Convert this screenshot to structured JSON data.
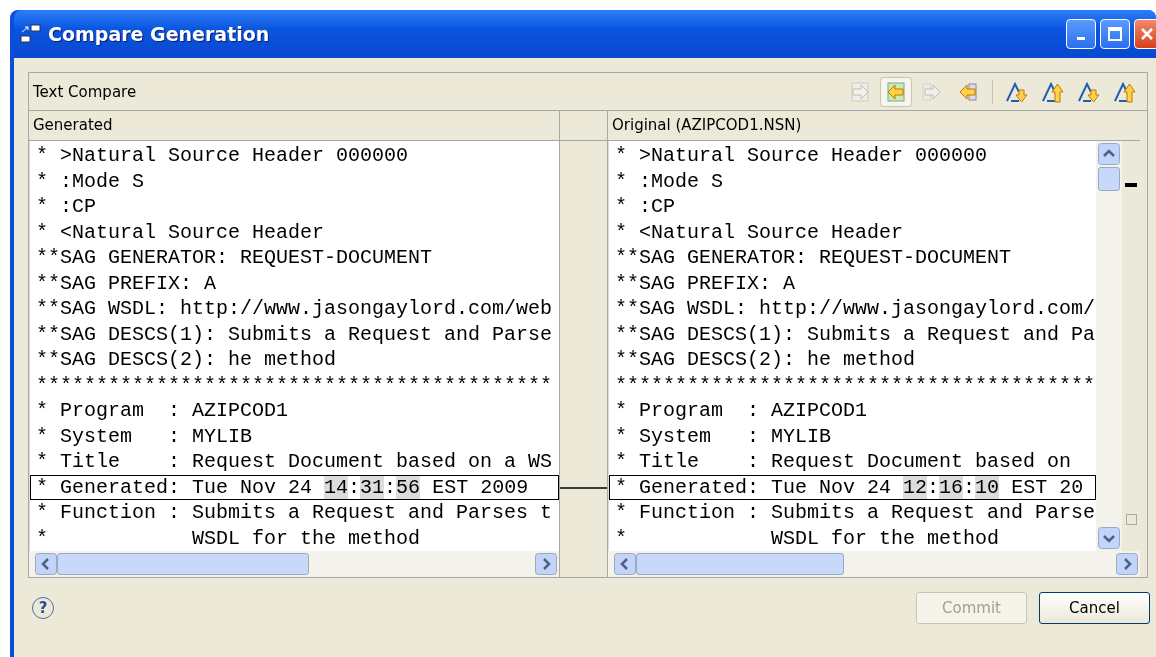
{
  "window": {
    "title": "Compare Generation"
  },
  "compare": {
    "title": "Text Compare",
    "toolbar_buttons": [
      {
        "kind": "copy-all-left-to-right",
        "disabled": true,
        "selected": false
      },
      {
        "kind": "copy-all-right-to-left",
        "disabled": false,
        "selected": true
      },
      {
        "kind": "copy-change-left-to-right",
        "disabled": true,
        "selected": false
      },
      {
        "kind": "copy-change-right-to-left",
        "disabled": false,
        "selected": false
      },
      {
        "kind": "next-difference",
        "disabled": false,
        "selected": false
      },
      {
        "kind": "previous-difference",
        "disabled": false,
        "selected": false
      },
      {
        "kind": "next-change",
        "disabled": false,
        "selected": false
      },
      {
        "kind": "previous-change",
        "disabled": false,
        "selected": false
      }
    ],
    "panes": [
      {
        "title": "Generated",
        "lines": [
          {
            "segments": [
              {
                "text": "* >Natural Source Header 000000",
                "changed": false
              }
            ],
            "selected": false
          },
          {
            "segments": [
              {
                "text": "* :Mode S",
                "changed": false
              }
            ],
            "selected": false
          },
          {
            "segments": [
              {
                "text": "* :CP",
                "changed": false
              }
            ],
            "selected": false
          },
          {
            "segments": [
              {
                "text": "* <Natural Source Header",
                "changed": false
              }
            ],
            "selected": false
          },
          {
            "segments": [
              {
                "text": "**SAG GENERATOR: REQUEST-DOCUMENT",
                "changed": false
              }
            ],
            "selected": false
          },
          {
            "segments": [
              {
                "text": "**SAG PREFIX: A",
                "changed": false
              }
            ],
            "selected": false
          },
          {
            "segments": [
              {
                "text": "**SAG WSDL: http://www.jasongaylord.com/web",
                "changed": false
              }
            ],
            "selected": false
          },
          {
            "segments": [
              {
                "text": "**SAG DESCS(1): Submits a Request and Parse",
                "changed": false
              }
            ],
            "selected": false
          },
          {
            "segments": [
              {
                "text": "**SAG DESCS(2): he method",
                "changed": false
              }
            ],
            "selected": false
          },
          {
            "segments": [
              {
                "text": "*******************************************",
                "changed": false
              }
            ],
            "selected": false
          },
          {
            "segments": [
              {
                "text": "* Program  : AZIPCOD1",
                "changed": false
              }
            ],
            "selected": false
          },
          {
            "segments": [
              {
                "text": "* System   : MYLIB",
                "changed": false
              }
            ],
            "selected": false
          },
          {
            "segments": [
              {
                "text": "* Title    : Request Document based on a WS",
                "changed": false
              }
            ],
            "selected": false
          },
          {
            "segments": [
              {
                "text": "* Generated: Tue Nov 24 ",
                "changed": false
              },
              {
                "text": "14",
                "changed": true
              },
              {
                "text": ":",
                "changed": false
              },
              {
                "text": "31",
                "changed": true
              },
              {
                "text": ":",
                "changed": false
              },
              {
                "text": "56",
                "changed": true
              },
              {
                "text": " EST 2009",
                "changed": false
              }
            ],
            "selected": true
          },
          {
            "segments": [
              {
                "text": "* Function : Submits a Request and Parses t",
                "changed": false
              }
            ],
            "selected": false
          },
          {
            "segments": [
              {
                "text": "*            WSDL for the method",
                "changed": false
              }
            ],
            "selected": false
          }
        ]
      },
      {
        "title": "Original (AZIPCOD1.NSN)",
        "lines": [
          {
            "segments": [
              {
                "text": "* >Natural Source Header 000000",
                "changed": false
              }
            ],
            "selected": false
          },
          {
            "segments": [
              {
                "text": "* :Mode S",
                "changed": false
              }
            ],
            "selected": false
          },
          {
            "segments": [
              {
                "text": "* :CP",
                "changed": false
              }
            ],
            "selected": false
          },
          {
            "segments": [
              {
                "text": "* <Natural Source Header",
                "changed": false
              }
            ],
            "selected": false
          },
          {
            "segments": [
              {
                "text": "**SAG GENERATOR: REQUEST-DOCUMENT",
                "changed": false
              }
            ],
            "selected": false
          },
          {
            "segments": [
              {
                "text": "**SAG PREFIX: A",
                "changed": false
              }
            ],
            "selected": false
          },
          {
            "segments": [
              {
                "text": "**SAG WSDL: http://www.jasongaylord.com/",
                "changed": false
              }
            ],
            "selected": false
          },
          {
            "segments": [
              {
                "text": "**SAG DESCS(1): Submits a Request and Pa",
                "changed": false
              }
            ],
            "selected": false
          },
          {
            "segments": [
              {
                "text": "**SAG DESCS(2): he method",
                "changed": false
              }
            ],
            "selected": false
          },
          {
            "segments": [
              {
                "text": "****************************************",
                "changed": false
              }
            ],
            "selected": false
          },
          {
            "segments": [
              {
                "text": "* Program  : AZIPCOD1",
                "changed": false
              }
            ],
            "selected": false
          },
          {
            "segments": [
              {
                "text": "* System   : MYLIB",
                "changed": false
              }
            ],
            "selected": false
          },
          {
            "segments": [
              {
                "text": "* Title    : Request Document based on",
                "changed": false
              }
            ],
            "selected": false
          },
          {
            "segments": [
              {
                "text": "* Generated: Tue Nov 24 ",
                "changed": false
              },
              {
                "text": "12",
                "changed": true
              },
              {
                "text": ":",
                "changed": false
              },
              {
                "text": "16",
                "changed": true
              },
              {
                "text": ":",
                "changed": false
              },
              {
                "text": "10",
                "changed": true
              },
              {
                "text": " EST 20",
                "changed": false
              }
            ],
            "selected": true
          },
          {
            "segments": [
              {
                "text": "* Function : Submits a Request and Parse",
                "changed": false
              }
            ],
            "selected": false
          },
          {
            "segments": [
              {
                "text": "*            WSDL for the method",
                "changed": false
              }
            ],
            "selected": false
          }
        ]
      }
    ]
  },
  "help": "?",
  "buttons": [
    {
      "label": "Commit",
      "disabled": true
    },
    {
      "label": "Cancel",
      "disabled": false
    }
  ]
}
